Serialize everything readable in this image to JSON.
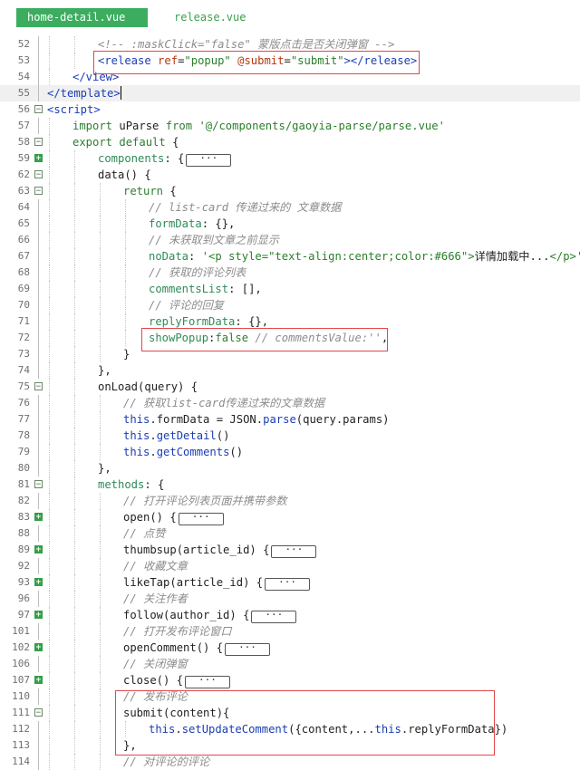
{
  "tabs": [
    {
      "label": "home-detail.vue",
      "active": true
    },
    {
      "label": "release.vue",
      "active": false
    }
  ],
  "collapsed_placeholder": "···",
  "lines": [
    {
      "num": "52",
      "indent": 2,
      "tokens": [
        [
          "cm",
          "<!-- :maskClick=\"false\" 蒙版点击是否关闭弹窗 -->"
        ]
      ]
    },
    {
      "num": "53",
      "indent": 2,
      "tokens": [
        [
          "tag",
          "<release "
        ],
        [
          "attr",
          "ref"
        ],
        [
          "",
          "="
        ],
        [
          "str",
          "\"popup\""
        ],
        [
          "",
          " "
        ],
        [
          "attr",
          "@submit"
        ],
        [
          "",
          "="
        ],
        [
          "str",
          "\"submit\""
        ],
        [
          "tag",
          "></release>"
        ]
      ]
    },
    {
      "num": "54",
      "indent": 1,
      "tokens": [
        [
          "tag",
          "</view>"
        ]
      ]
    },
    {
      "num": "55",
      "indent": 0,
      "hl": true,
      "cursor": true,
      "tokens": [
        [
          "tag",
          "</template>"
        ]
      ]
    },
    {
      "num": "56",
      "indent": 0,
      "fold": "open",
      "tokens": [
        [
          "tag",
          "<script>"
        ]
      ]
    },
    {
      "num": "57",
      "indent": 1,
      "tokens": [
        [
          "kw",
          "import "
        ],
        [
          "",
          "uParse "
        ],
        [
          "kw",
          "from "
        ],
        [
          "str",
          "'@/components/gaoyia-parse/parse.vue'"
        ]
      ]
    },
    {
      "num": "58",
      "indent": 1,
      "fold": "open",
      "tokens": [
        [
          "kw",
          "export default "
        ],
        [
          "",
          "{"
        ]
      ]
    },
    {
      "num": "59",
      "indent": 2,
      "fold": "closed",
      "pill": true,
      "tokens": [
        [
          "prop",
          "components"
        ],
        [
          "",
          ": {"
        ]
      ]
    },
    {
      "num": "62",
      "indent": 2,
      "fold": "open",
      "tokens": [
        [
          "",
          "data() {"
        ]
      ]
    },
    {
      "num": "63",
      "indent": 3,
      "fold": "open",
      "tokens": [
        [
          "kw",
          "return "
        ],
        [
          "",
          "{"
        ]
      ]
    },
    {
      "num": "64",
      "indent": 4,
      "tokens": [
        [
          "cm",
          "// list-card 传递过来的 文章数据"
        ]
      ]
    },
    {
      "num": "65",
      "indent": 4,
      "tokens": [
        [
          "prop",
          "formData"
        ],
        [
          "",
          ": {},"
        ]
      ]
    },
    {
      "num": "66",
      "indent": 4,
      "tokens": [
        [
          "cm",
          "// 未获取到文章之前显示"
        ]
      ]
    },
    {
      "num": "67",
      "indent": 4,
      "tokens": [
        [
          "prop",
          "noData"
        ],
        [
          "",
          ": "
        ],
        [
          "str",
          "'<p style=\"text-align:center;color:#666\">"
        ],
        [
          "",
          "详情加载中..."
        ],
        [
          "str",
          "</p>'"
        ],
        [
          "",
          ","
        ]
      ]
    },
    {
      "num": "68",
      "indent": 4,
      "tokens": [
        [
          "cm",
          "// 获取的评论列表"
        ]
      ]
    },
    {
      "num": "69",
      "indent": 4,
      "tokens": [
        [
          "prop",
          "commentsList"
        ],
        [
          "",
          ": [],"
        ]
      ]
    },
    {
      "num": "70",
      "indent": 4,
      "tokens": [
        [
          "cm",
          "// 评论的回复"
        ]
      ]
    },
    {
      "num": "71",
      "indent": 4,
      "tokens": [
        [
          "prop",
          "replyFormData"
        ],
        [
          "",
          ": {},"
        ]
      ]
    },
    {
      "num": "72",
      "indent": 4,
      "tokens": [
        [
          "prop",
          "showPopup"
        ],
        [
          "",
          ":"
        ],
        [
          "kw",
          "false"
        ],
        [
          "cm",
          " // commentsValue:''"
        ],
        [
          "",
          ","
        ]
      ]
    },
    {
      "num": "73",
      "indent": 3,
      "tokens": [
        [
          "",
          "}"
        ]
      ]
    },
    {
      "num": "74",
      "indent": 2,
      "tokens": [
        [
          "",
          "},"
        ]
      ]
    },
    {
      "num": "75",
      "indent": 2,
      "fold": "open",
      "tokens": [
        [
          "",
          "onLoad(query) {"
        ]
      ]
    },
    {
      "num": "76",
      "indent": 3,
      "tokens": [
        [
          "cm",
          "// 获取list-card传递过来的文章数据"
        ]
      ]
    },
    {
      "num": "77",
      "indent": 3,
      "tokens": [
        [
          "this",
          "this"
        ],
        [
          "",
          ".formData = JSON."
        ],
        [
          "fn",
          "parse"
        ],
        [
          "",
          "(query.params)"
        ]
      ]
    },
    {
      "num": "78",
      "indent": 3,
      "tokens": [
        [
          "this",
          "this"
        ],
        [
          "",
          "."
        ],
        [
          "fn",
          "getDetail"
        ],
        [
          "",
          "()"
        ]
      ]
    },
    {
      "num": "79",
      "indent": 3,
      "tokens": [
        [
          "this",
          "this"
        ],
        [
          "",
          "."
        ],
        [
          "fn",
          "getComments"
        ],
        [
          "",
          "()"
        ]
      ]
    },
    {
      "num": "80",
      "indent": 2,
      "tokens": [
        [
          "",
          "},"
        ]
      ]
    },
    {
      "num": "81",
      "indent": 2,
      "fold": "open",
      "tokens": [
        [
          "prop",
          "methods"
        ],
        [
          "",
          ": {"
        ]
      ]
    },
    {
      "num": "82",
      "indent": 3,
      "tokens": [
        [
          "cm",
          "// 打开评论列表页面并携带参数"
        ]
      ]
    },
    {
      "num": "83",
      "indent": 3,
      "fold": "closed",
      "pill": true,
      "tokens": [
        [
          "",
          "open() {"
        ]
      ]
    },
    {
      "num": "88",
      "indent": 3,
      "tokens": [
        [
          "cm",
          "// 点赞"
        ]
      ]
    },
    {
      "num": "89",
      "indent": 3,
      "fold": "closed",
      "pill": true,
      "tokens": [
        [
          "",
          "thumbsup(article_id) {"
        ]
      ]
    },
    {
      "num": "92",
      "indent": 3,
      "tokens": [
        [
          "cm",
          "// 收藏文章"
        ]
      ]
    },
    {
      "num": "93",
      "indent": 3,
      "fold": "closed",
      "pill": true,
      "tokens": [
        [
          "",
          "likeTap(article_id) {"
        ]
      ]
    },
    {
      "num": "96",
      "indent": 3,
      "tokens": [
        [
          "cm",
          "// 关注作者"
        ]
      ]
    },
    {
      "num": "97",
      "indent": 3,
      "fold": "closed",
      "pill": true,
      "tokens": [
        [
          "",
          "follow(author_id) {"
        ]
      ]
    },
    {
      "num": "101",
      "indent": 3,
      "tokens": [
        [
          "cm",
          "// 打开发布评论窗口"
        ]
      ]
    },
    {
      "num": "102",
      "indent": 3,
      "fold": "closed",
      "pill": true,
      "tokens": [
        [
          "",
          "openComment() {"
        ]
      ]
    },
    {
      "num": "106",
      "indent": 3,
      "tokens": [
        [
          "cm",
          "// 关闭弹窗"
        ]
      ]
    },
    {
      "num": "107",
      "indent": 3,
      "fold": "closed",
      "pill": true,
      "tokens": [
        [
          "",
          "close() {"
        ]
      ]
    },
    {
      "num": "110",
      "indent": 3,
      "tokens": [
        [
          "cm",
          "// 发布评论"
        ]
      ]
    },
    {
      "num": "111",
      "indent": 3,
      "fold": "open",
      "tokens": [
        [
          "",
          "submit(content){"
        ]
      ]
    },
    {
      "num": "112",
      "indent": 4,
      "tokens": [
        [
          "this",
          "this"
        ],
        [
          "",
          "."
        ],
        [
          "fn",
          "setUpdateComment"
        ],
        [
          "",
          "({content,..."
        ],
        [
          "this",
          "this"
        ],
        [
          "",
          ".replyFormData})"
        ]
      ]
    },
    {
      "num": "113",
      "indent": 3,
      "tokens": [
        [
          "",
          "},"
        ]
      ]
    },
    {
      "num": "114",
      "indent": 3,
      "tokens": [
        [
          "cm",
          "// 对评论的评论"
        ]
      ]
    }
  ]
}
